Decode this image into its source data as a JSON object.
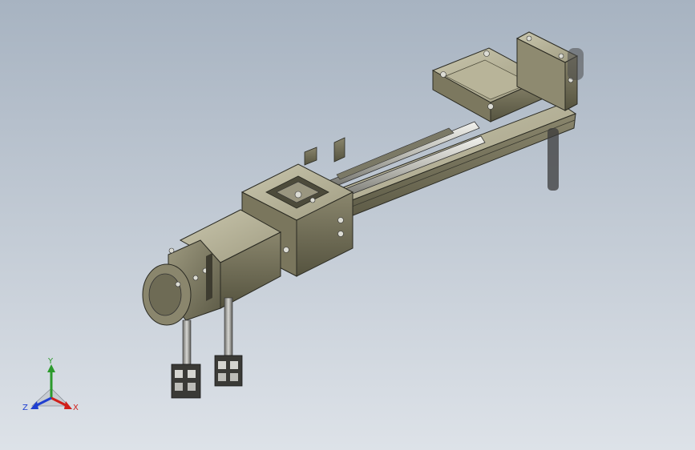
{
  "triad": {
    "x_label": "X",
    "y_label": "Y",
    "z_label": "Z",
    "x_color": "#d0201a",
    "y_color": "#2c9a2c",
    "z_color": "#1f3fd0"
  },
  "background": {
    "top": "#a7b3c1",
    "bottom": "#dde2e8"
  },
  "parts": [
    "linear-actuator-body",
    "servo-motor",
    "coupling-housing",
    "carriage-table",
    "end-plate",
    "guide-rods",
    "motor-cables",
    "connector-plugs"
  ]
}
